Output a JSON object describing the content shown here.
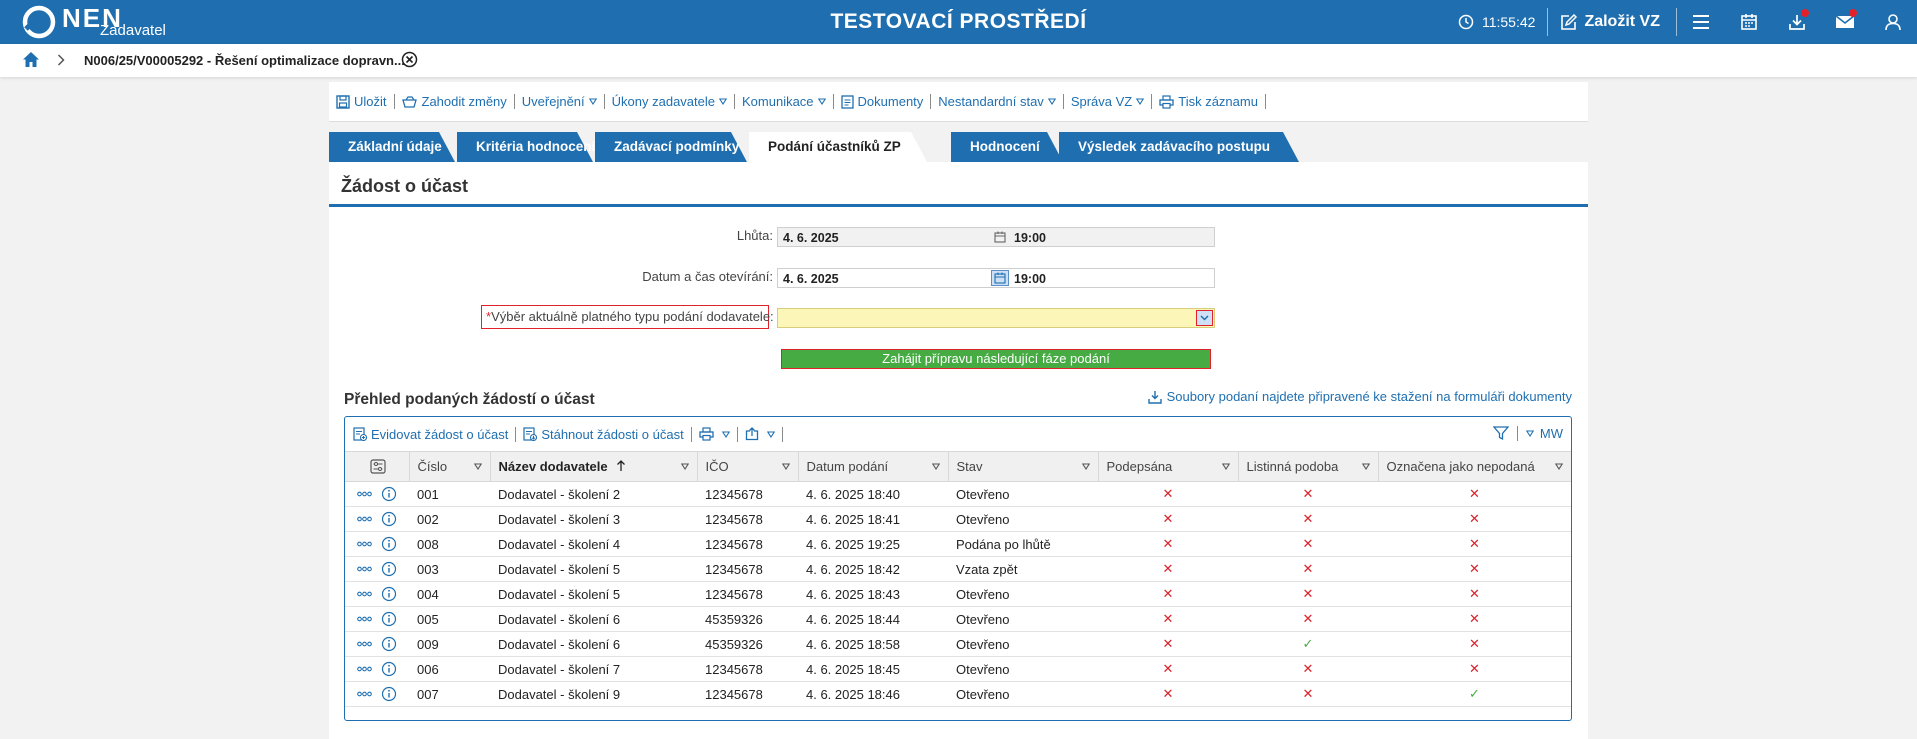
{
  "app": {
    "logo_text": "NEN",
    "logo_sub": "Zadavatel",
    "env_title": "TESTOVACÍ PROSTŘEDÍ",
    "clock": "11:55:42",
    "create_vz": "Založit VZ"
  },
  "breadcrumb": {
    "text": "N006/25/V00005292 - Řešení optimalizace dopravn..."
  },
  "toolbar": {
    "items": [
      {
        "label": "Uložit"
      },
      {
        "label": "Zahodit změny"
      },
      {
        "label": "Uveřejnění"
      },
      {
        "label": "Úkony zadavatele"
      },
      {
        "label": "Komunikace"
      },
      {
        "label": "Dokumenty"
      },
      {
        "label": "Nestandardní stav"
      },
      {
        "label": "Správa VZ"
      },
      {
        "label": "Tisk záznamu"
      }
    ]
  },
  "tabs": [
    {
      "label": "Základní údaje"
    },
    {
      "label": "Kritéria hodnocení"
    },
    {
      "label": "Zadávací podmínky"
    },
    {
      "label": "Podání účastníků ZP"
    },
    {
      "label": "Hodnocení"
    },
    {
      "label": "Výsledek zadávacího postupu"
    }
  ],
  "section_title": "Žádost o účast",
  "form": {
    "deadline_label": "Lhůta:",
    "deadline_date": "4. 6. 2025",
    "deadline_time": "19:00",
    "open_label": "Datum a čas otevírání:",
    "open_date": "4. 6. 2025",
    "open_time": "19:00",
    "type_label": "Výběr aktuálně platného typu podání dodavatele:",
    "type_value": "",
    "start_button": "Zahájit přípravu následující fáze podání"
  },
  "list": {
    "title": "Přehled podaných žádostí o účast",
    "files_link": "Soubory podaní najdete připravené ke stažení na formuláři dokumenty",
    "tool_add": "Evidovat žádost o účast",
    "tool_download": "Stáhnout žádosti o účast",
    "mw": "MW",
    "columns": [
      "Číslo",
      "Název dodavatele",
      "IČO",
      "Datum podání",
      "Stav",
      "Podepsána",
      "Listinná podoba",
      "Označena jako nepodaná"
    ],
    "rows": [
      {
        "cislo": "001",
        "nazev": "Dodavatel - školení 2",
        "ico": "12345678",
        "datum": "4. 6. 2025 18:40",
        "stav": "Otevřeno",
        "podepsana": "✕",
        "listinna": "✕",
        "nepodana": "✕"
      },
      {
        "cislo": "002",
        "nazev": "Dodavatel - školení 3",
        "ico": "12345678",
        "datum": "4. 6. 2025 18:41",
        "stav": "Otevřeno",
        "podepsana": "✕",
        "listinna": "✕",
        "nepodana": "✕"
      },
      {
        "cislo": "008",
        "nazev": "Dodavatel - školení 4",
        "ico": "12345678",
        "datum": "4. 6. 2025 19:25",
        "stav": "Podána po lhůtě",
        "podepsana": "✕",
        "listinna": "✕",
        "nepodana": "✕"
      },
      {
        "cislo": "003",
        "nazev": "Dodavatel - školení 5",
        "ico": "12345678",
        "datum": "4. 6. 2025 18:42",
        "stav": "Vzata zpět",
        "podepsana": "✕",
        "listinna": "✕",
        "nepodana": "✕"
      },
      {
        "cislo": "004",
        "nazev": "Dodavatel - školení 5",
        "ico": "12345678",
        "datum": "4. 6. 2025 18:43",
        "stav": "Otevřeno",
        "podepsana": "✕",
        "listinna": "✕",
        "nepodana": "✕"
      },
      {
        "cislo": "005",
        "nazev": "Dodavatel - školení 6",
        "ico": "45359326",
        "datum": "4. 6. 2025 18:44",
        "stav": "Otevřeno",
        "podepsana": "✕",
        "listinna": "✕",
        "nepodana": "✕"
      },
      {
        "cislo": "009",
        "nazev": "Dodavatel - školení 6",
        "ico": "45359326",
        "datum": "4. 6. 2025 18:58",
        "stav": "Otevřeno",
        "podepsana": "✕",
        "listinna": "✓",
        "nepodana": "✕"
      },
      {
        "cislo": "006",
        "nazev": "Dodavatel - školení 7",
        "ico": "12345678",
        "datum": "4. 6. 2025 18:45",
        "stav": "Otevřeno",
        "podepsana": "✕",
        "listinna": "✕",
        "nepodana": "✕"
      },
      {
        "cislo": "007",
        "nazev": "Dodavatel - školení 9",
        "ico": "12345678",
        "datum": "4. 6. 2025 18:46",
        "stav": "Otevřeno",
        "podepsana": "✕",
        "listinna": "✕",
        "nepodana": "✓"
      }
    ]
  },
  "colors": {
    "primary": "#1f6fb0",
    "success": "#47ab43",
    "danger": "#d9232b",
    "required_bg": "#fdf6b9"
  }
}
